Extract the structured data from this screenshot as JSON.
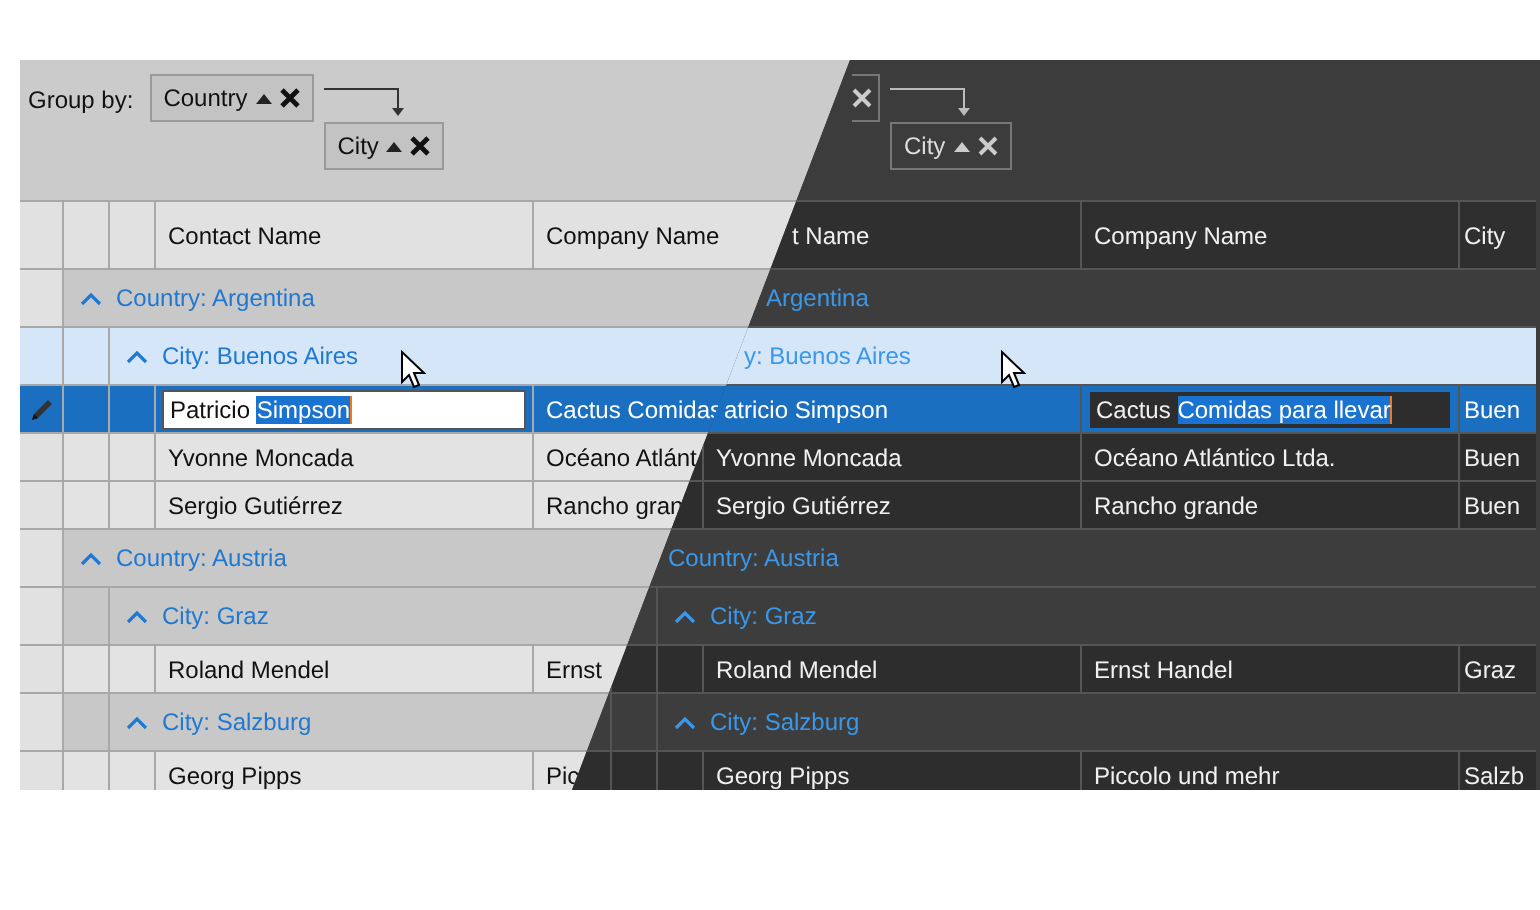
{
  "light_theme": {
    "group_panel": {
      "label": "Group by:",
      "chips": [
        {
          "kind": "full",
          "label": "Country",
          "sort_ascending": true
        },
        {
          "kind": "full",
          "label": "City",
          "sort_ascending": true
        }
      ]
    },
    "columns": [
      "Contact Name",
      "Company Name"
    ],
    "groups": [
      {
        "title": "Country: Argentina",
        "expanded": true,
        "hovered": false,
        "children": [
          {
            "title": "City: Buenos Aires",
            "expanded": true,
            "hovered": true,
            "rows": [
              {
                "selected": true,
                "cells": [
                  {
                    "text": "Patricio ",
                    "selection": "Simpson",
                    "editing": true
                  },
                  {
                    "text": "Cactus Comidas",
                    "editing": false
                  }
                ]
              },
              {
                "selected": false,
                "cells": [
                  {
                    "text": "Yvonne Moncada",
                    "editing": false
                  },
                  {
                    "text": "Océano Atlánt",
                    "editing": false
                  }
                ]
              },
              {
                "selected": false,
                "cells": [
                  {
                    "text": "Sergio Gutiérrez",
                    "editing": false
                  },
                  {
                    "text": "Rancho gran",
                    "editing": false
                  }
                ]
              }
            ]
          }
        ]
      },
      {
        "title": "Country: Austria",
        "expanded": true,
        "hovered": false,
        "children": [
          {
            "title": "City: Graz",
            "expanded": true,
            "hovered": false,
            "rows": [
              {
                "selected": false,
                "cells": [
                  {
                    "text": "Roland Mendel",
                    "editing": false
                  },
                  {
                    "text": "Ernst",
                    "editing": false
                  }
                ]
              }
            ]
          },
          {
            "title": "City: Salzburg",
            "expanded": true,
            "hovered": false,
            "rows": [
              {
                "selected": false,
                "cells": [
                  {
                    "text": "Georg Pipps",
                    "editing": false
                  },
                  {
                    "text": "Pic",
                    "editing": false
                  }
                ]
              }
            ]
          }
        ]
      }
    ]
  },
  "dark_theme": {
    "group_panel": {
      "chips": [
        {
          "kind": "clipped"
        },
        {
          "kind": "full",
          "label": "City",
          "sort_ascending": true
        }
      ]
    },
    "columns": [
      "t Name",
      "Company Name",
      "City"
    ],
    "groups": [
      {
        "title": "Argentina",
        "hovered": false,
        "children": [
          {
            "title": "y: Buenos Aires",
            "hovered": true,
            "rows": [
              {
                "selected": true,
                "cells": [
                  {
                    "text": "atricio Simpson",
                    "editing": false
                  },
                  {
                    "text": "Cactus ",
                    "selection": "Comidas para llevar",
                    "editing": true
                  },
                  {
                    "text": "Buen",
                    "editing": false
                  }
                ]
              },
              {
                "selected": false,
                "cells": [
                  {
                    "text": "Yvonne Moncada",
                    "editing": false
                  },
                  {
                    "text": "Océano Atlántico Ltda.",
                    "editing": false
                  },
                  {
                    "text": "Buen",
                    "editing": false
                  }
                ]
              },
              {
                "selected": false,
                "cells": [
                  {
                    "text": "Sergio Gutiérrez",
                    "editing": false
                  },
                  {
                    "text": "Rancho grande",
                    "editing": false
                  },
                  {
                    "text": "Buen",
                    "editing": false
                  }
                ]
              }
            ]
          }
        ]
      },
      {
        "title": "Country: Austria",
        "hovered": false,
        "children": [
          {
            "title": "City: Graz",
            "expanded": true,
            "hovered": false,
            "rows": [
              {
                "selected": false,
                "cells": [
                  {
                    "text": "Roland Mendel",
                    "editing": false
                  },
                  {
                    "text": "Ernst Handel",
                    "editing": false
                  },
                  {
                    "text": "Graz",
                    "editing": false
                  }
                ]
              }
            ]
          },
          {
            "title": "City: Salzburg",
            "expanded": true,
            "hovered": false,
            "rows": [
              {
                "selected": false,
                "cells": [
                  {
                    "text": "Georg Pipps",
                    "editing": false
                  },
                  {
                    "text": "Piccolo und mehr",
                    "editing": false
                  },
                  {
                    "text": "Salzb",
                    "editing": false
                  }
                ]
              }
            ]
          }
        ]
      }
    ]
  }
}
